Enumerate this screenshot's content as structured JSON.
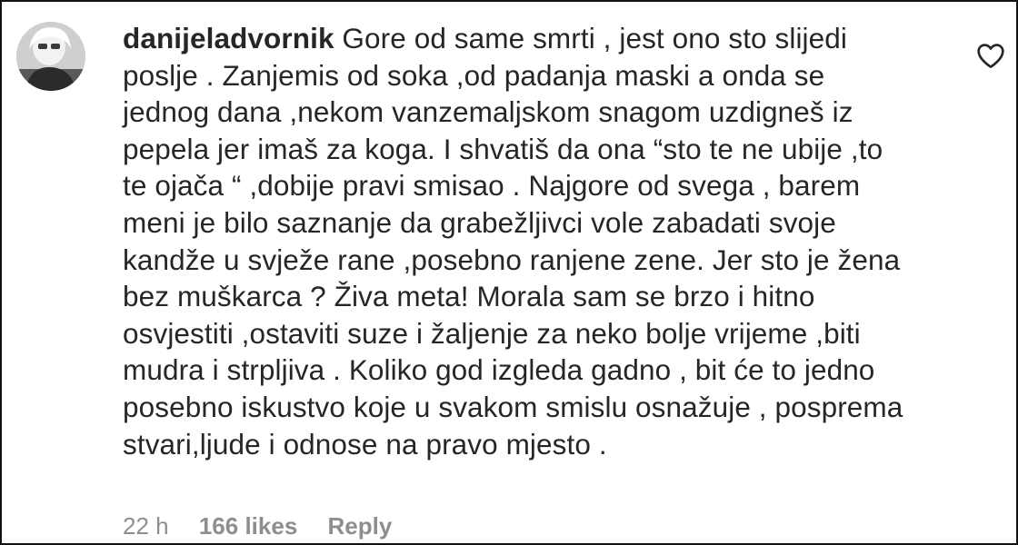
{
  "comment": {
    "username": "danijeladvornik",
    "lines": [
      " Gore od same smrti , jest ono sto slijedi",
      "poslje . Zanjemis od soka ,od padanja maski a onda se",
      "jednog dana ,nekom vanzemaljskom snagom uzdigneš iz",
      "pepela jer imaš za koga. I shvatiš da ona “sto te ne ubije ,to",
      "te ojača “ ,dobije pravi smisao . Najgore od svega , barem",
      "meni je bilo saznanje da grabežljivci vole zabadati svoje",
      "kandže u svježe rane ,posebno ranjene zene. Jer sto je žena",
      "bez muškarca ? Živa meta! Morala sam se brzo i hitno",
      "osvjestiti ,ostaviti suze i žaljenje za neko bolje vrijeme ,biti",
      "mudra i strpljiva . Koliko god izgleda gadno , bit će to jedno",
      "posebno iskustvo koje u svakom smislu osnažuje , posprema",
      "stvari,ljude i odnose na pravo mjesto ."
    ]
  },
  "meta": {
    "time": "22 h",
    "likes": "166 likes",
    "reply": "Reply"
  },
  "icons": {
    "avatar": "profile-photo",
    "like": "heart-outline-icon"
  },
  "colors": {
    "text": "#262626",
    "secondary": "#8e8e8e",
    "border": "#111111"
  }
}
